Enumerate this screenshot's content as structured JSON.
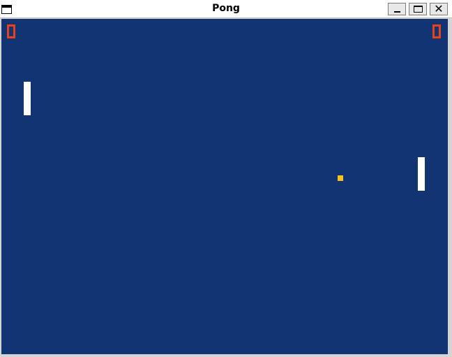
{
  "window": {
    "title": "Pong",
    "controls": {
      "minimize_icon": "minimize-icon",
      "maximize_icon": "maximize-icon",
      "close_icon": "close-icon",
      "close_glyph": "✕"
    }
  },
  "game": {
    "court_color": "#123473",
    "paddle_color": "#ffffff",
    "ball_color": "#f7c31a",
    "score_color": "#e8421a",
    "scores": {
      "left": "0",
      "right": "0"
    }
  }
}
